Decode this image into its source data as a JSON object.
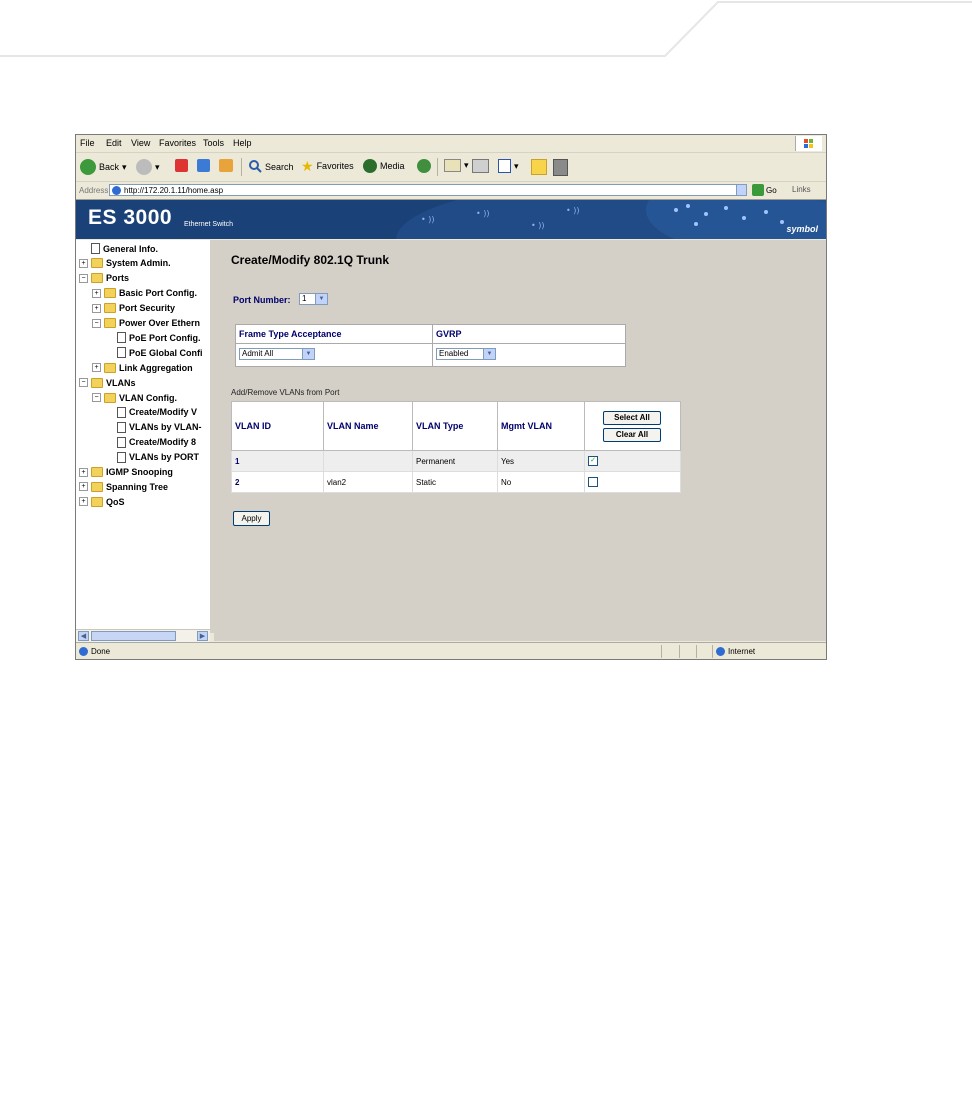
{
  "menu": [
    "File",
    "Edit",
    "View",
    "Favorites",
    "Tools",
    "Help"
  ],
  "toolbar": {
    "back": "Back",
    "search": "Search",
    "favorites": "Favorites",
    "media": "Media"
  },
  "address": {
    "label": "Address",
    "url": "http://172.20.1.11/home.asp",
    "go": "Go",
    "links": "Links"
  },
  "banner": {
    "title": "ES 3000",
    "subtitle": "Ethernet Switch",
    "logo": "symbol"
  },
  "nav": {
    "items": [
      {
        "label": "General Info.",
        "type": "doc",
        "level": 0,
        "expander": ""
      },
      {
        "label": "System Admin.",
        "type": "folder",
        "level": 0,
        "expander": "+"
      },
      {
        "label": "Ports",
        "type": "folder-open",
        "level": 0,
        "expander": "−"
      },
      {
        "label": "Basic Port Config.",
        "type": "folder",
        "level": 1,
        "expander": "+"
      },
      {
        "label": "Port Security",
        "type": "folder",
        "level": 1,
        "expander": "+"
      },
      {
        "label": "Power Over Ethern",
        "type": "folder-open",
        "level": 1,
        "expander": "−"
      },
      {
        "label": "PoE Port Config.",
        "type": "doc",
        "level": 2,
        "expander": ""
      },
      {
        "label": "PoE Global Confi",
        "type": "doc",
        "level": 2,
        "expander": ""
      },
      {
        "label": "Link Aggregation",
        "type": "folder",
        "level": 1,
        "expander": "+"
      },
      {
        "label": "VLANs",
        "type": "folder-open",
        "level": 0,
        "expander": "−"
      },
      {
        "label": "VLAN Config.",
        "type": "folder-open",
        "level": 1,
        "expander": "−"
      },
      {
        "label": "Create/Modify V",
        "type": "doc",
        "level": 2,
        "expander": ""
      },
      {
        "label": "VLANs by VLAN-",
        "type": "doc",
        "level": 2,
        "expander": ""
      },
      {
        "label": "Create/Modify 8",
        "type": "doc",
        "level": 2,
        "expander": ""
      },
      {
        "label": "VLANs by PORT",
        "type": "doc",
        "level": 2,
        "expander": ""
      },
      {
        "label": "IGMP Snooping",
        "type": "folder",
        "level": 0,
        "expander": "+"
      },
      {
        "label": "Spanning Tree",
        "type": "folder",
        "level": 0,
        "expander": "+"
      },
      {
        "label": "QoS",
        "type": "folder",
        "level": 0,
        "expander": "+"
      }
    ]
  },
  "main": {
    "title": "Create/Modify 802.1Q Trunk",
    "port_number_label": "Port Number:",
    "port_number_value": "1",
    "frame_type_header": "Frame Type Acceptance",
    "frame_type_value": "Admit All",
    "gvrp_header": "GVRP",
    "gvrp_value": "Enabled",
    "vlan_section_label": "Add/Remove VLANs from Port",
    "columns": [
      "VLAN ID",
      "VLAN Name",
      "VLAN Type",
      "Mgmt VLAN"
    ],
    "select_all": "Select All",
    "clear_all": "Clear All",
    "rows": [
      {
        "id": "1",
        "name": "",
        "type": "Permanent",
        "mgmt": "Yes",
        "checked": true
      },
      {
        "id": "2",
        "name": "vlan2",
        "type": "Static",
        "mgmt": "No",
        "checked": false
      }
    ],
    "apply": "Apply"
  },
  "status": {
    "text": "Done",
    "zone": "Internet"
  },
  "colors": {
    "banner": "#1b4278",
    "link": "#00006b",
    "content_bg": "#d4d0c8"
  }
}
